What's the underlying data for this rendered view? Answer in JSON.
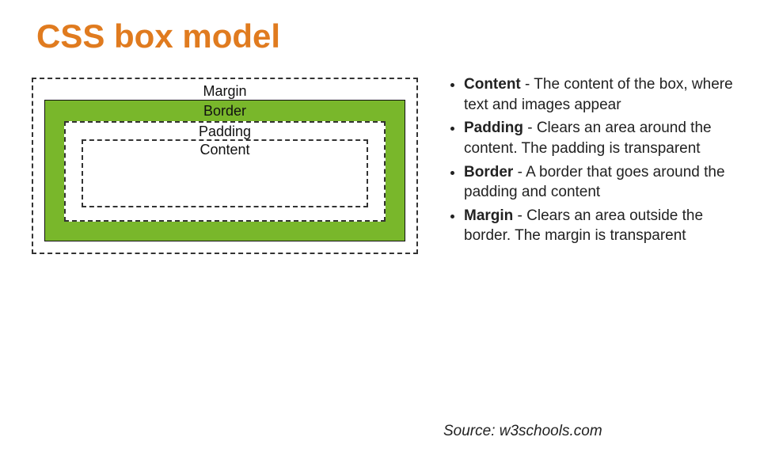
{
  "title": "CSS box model",
  "diagram": {
    "margin_label": "Margin",
    "border_label": "Border",
    "padding_label": "Padding",
    "content_label": "Content"
  },
  "definitions": [
    {
      "term": "Content",
      "desc": " - The content of the box, where text and images appear"
    },
    {
      "term": "Padding",
      "desc": " - Clears an area around the content. The padding is transparent"
    },
    {
      "term": "Border",
      "desc": " - A border that goes around the padding and content"
    },
    {
      "term": "Margin",
      "desc": " - Clears an area outside the border. The margin is transparent"
    }
  ],
  "source": "Source: w3schools.com"
}
